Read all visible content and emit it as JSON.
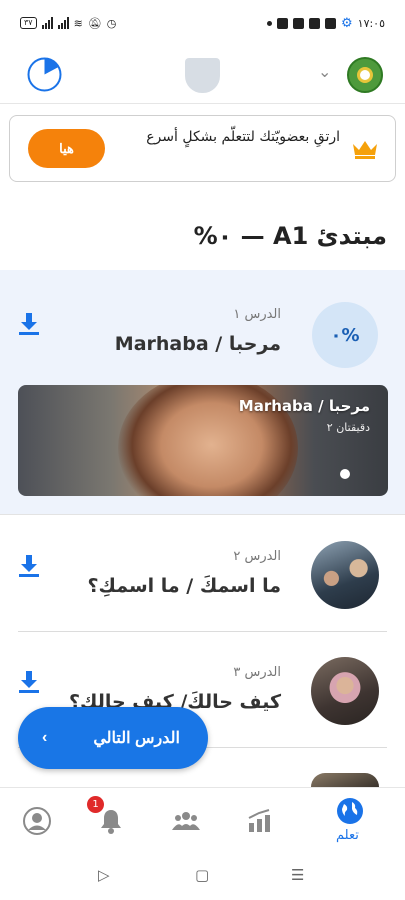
{
  "status_bar": {
    "time": "١٧:٠٥",
    "battery": "٣٧"
  },
  "banner": {
    "text": "ارتقِ بعضويّتك لتتعلّم بشكلٍ أسرع",
    "button": "هيا"
  },
  "level": {
    "title": "مبتدئ A1 — ٠%"
  },
  "lessons": [
    {
      "number": "الدرس ١",
      "title": "مرحبا / Marhaba",
      "progress": "٠%",
      "video_title": "مرحبا / Marhaba",
      "video_duration": "دقيقتان ٢"
    },
    {
      "number": "الدرس ٢",
      "title": "ما اسمكَ / ما اسمكِ؟"
    },
    {
      "number": "الدرس ٣",
      "title": "كيف حالكَ/ كيف حالكِ؟"
    }
  ],
  "next_button": {
    "label": "الدرس التالي"
  },
  "bottom_nav": {
    "notifications_badge": "1",
    "learn_label": "تعلم"
  },
  "colors": {
    "accent": "#1976e6",
    "banner_button": "#f5820b",
    "badge": "#e02a2a",
    "lesson_highlight": "#eef3fc"
  },
  "icons": [
    "progress-ring-icon",
    "profile-shield-icon",
    "chevron-down-icon",
    "language-flag-icon",
    "crown-icon",
    "download-icon",
    "chevron-left-icon",
    "profile-icon",
    "bell-icon",
    "community-icon",
    "stats-icon",
    "globe-icon",
    "back-icon",
    "home-icon",
    "recents-icon"
  ]
}
